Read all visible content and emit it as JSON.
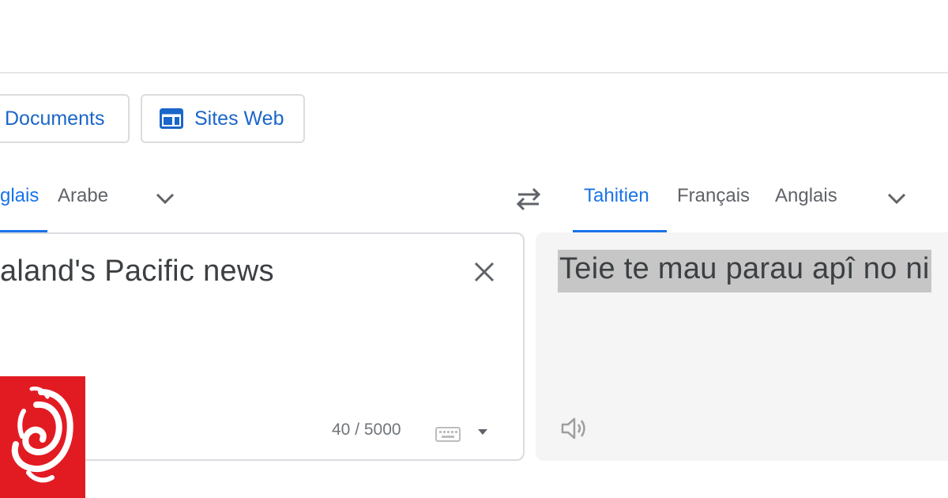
{
  "modes": {
    "documents_label": "Documents",
    "sites_label": "Sites Web"
  },
  "source_languages": {
    "tabs": [
      "glais",
      "Arabe"
    ],
    "active_index": 0
  },
  "target_languages": {
    "tabs": [
      "Tahitien",
      "Français",
      "Anglais"
    ],
    "active_index": 0
  },
  "source": {
    "text": "aland's Pacific news",
    "char_count": "40 / 5000"
  },
  "target": {
    "text": "Teie te mau parau apî no ni"
  },
  "colors": {
    "accent": "#1a73e8",
    "logo_red": "#e21b23",
    "highlight": "#c6c6c6"
  },
  "icons": {
    "sites": "web-icon",
    "chevron": "chevron-down-icon",
    "swap": "swap-icon",
    "clear": "close-icon",
    "keyboard": "keyboard-icon",
    "speaker": "speaker-icon",
    "logo": "rnz-logo"
  }
}
